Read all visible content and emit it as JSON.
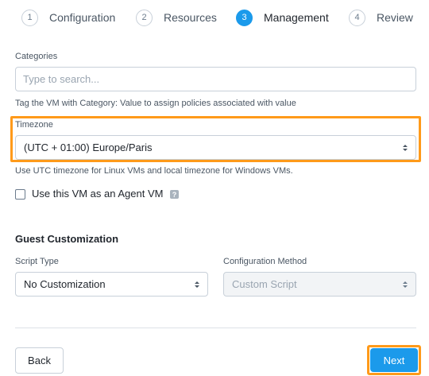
{
  "steps": [
    {
      "num": "1",
      "label": "Configuration"
    },
    {
      "num": "2",
      "label": "Resources"
    },
    {
      "num": "3",
      "label": "Management"
    },
    {
      "num": "4",
      "label": "Review"
    }
  ],
  "categories": {
    "label": "Categories",
    "placeholder": "Type to search...",
    "help": "Tag the VM with Category: Value to assign policies associated with value"
  },
  "timezone": {
    "label": "Timezone",
    "value": "(UTC + 01:00) Europe/Paris",
    "help": "Use UTC timezone for Linux VMs and local timezone for Windows VMs."
  },
  "agent_vm": {
    "label": "Use this VM as an Agent VM",
    "checked": false,
    "help_glyph": "?"
  },
  "guest": {
    "title": "Guest Customization",
    "script_type_label": "Script Type",
    "script_type_value": "No Customization",
    "config_method_label": "Configuration Method",
    "config_method_value": "Custom Script"
  },
  "footer": {
    "back_label": "Back",
    "next_label": "Next"
  },
  "colors": {
    "accent": "#1b9aeb",
    "highlight": "#ff9a1a"
  }
}
